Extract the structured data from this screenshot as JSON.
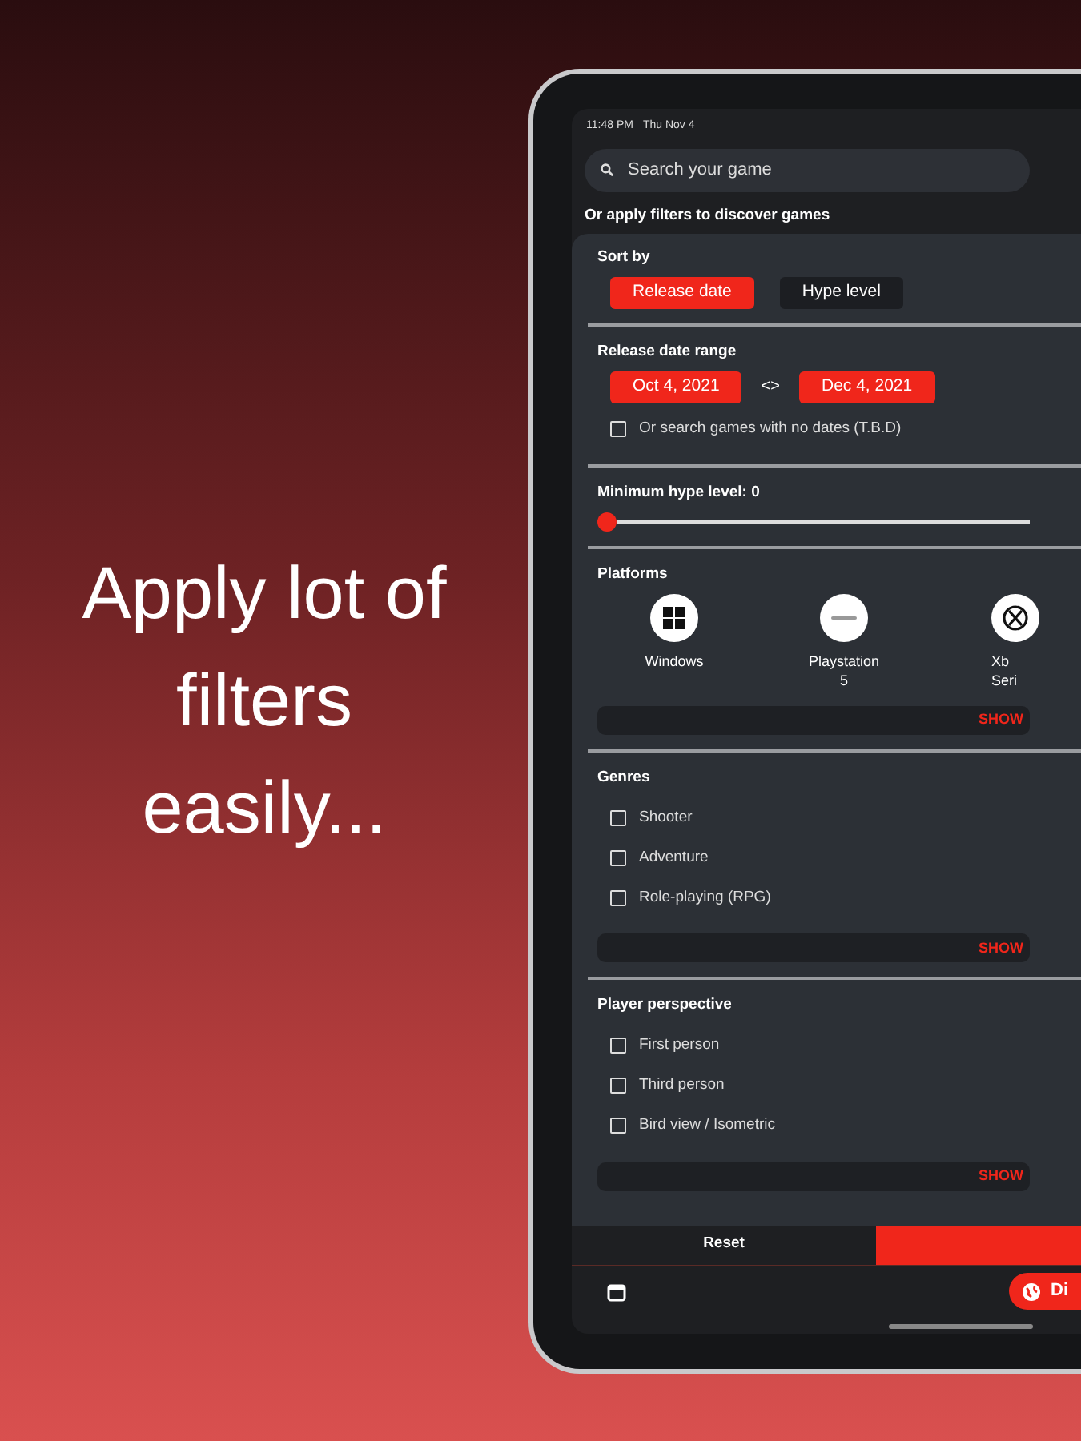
{
  "headline": "Apply lot of filters easily...",
  "status_bar": {
    "time": "11:48 PM",
    "date": "Thu Nov 4"
  },
  "search": {
    "placeholder": "Search your game"
  },
  "filters_hint": "Or apply filters to discover games",
  "sort": {
    "label": "Sort by",
    "options": [
      {
        "label": "Release date",
        "selected": true
      },
      {
        "label": "Hype level",
        "selected": false
      }
    ]
  },
  "date_range": {
    "label": "Release date range",
    "from": "Oct 4, 2021",
    "separator": "<>",
    "to": "Dec 4, 2021",
    "no_dates": {
      "label": "Or search games with no dates (T.B.D)",
      "checked": false
    }
  },
  "hype": {
    "label": "Minimum hype level: 0",
    "level": 0
  },
  "platforms": {
    "label": "Platforms",
    "items": [
      {
        "kind": "windows",
        "lines": [
          "Windows"
        ]
      },
      {
        "kind": "ps5",
        "lines": [
          "Playstation",
          "5"
        ]
      },
      {
        "kind": "xbox",
        "lines": [
          "Xb",
          "Seri"
        ]
      }
    ],
    "show_more": "SHOW"
  },
  "genres": {
    "label": "Genres",
    "items": [
      {
        "label": "Shooter",
        "checked": false
      },
      {
        "label": "Adventure",
        "checked": false
      },
      {
        "label": "Role-playing (RPG)",
        "checked": false
      }
    ],
    "show_more": "SHOW"
  },
  "perspective": {
    "label": "Player perspective",
    "items": [
      {
        "label": "First person",
        "checked": false
      },
      {
        "label": "Third person",
        "checked": false
      },
      {
        "label": "Bird view / Isometric",
        "checked": false
      }
    ],
    "show_more": "SHOW"
  },
  "actions": {
    "reset": "Reset"
  },
  "bottom_nav": {
    "discover": "Di"
  }
}
